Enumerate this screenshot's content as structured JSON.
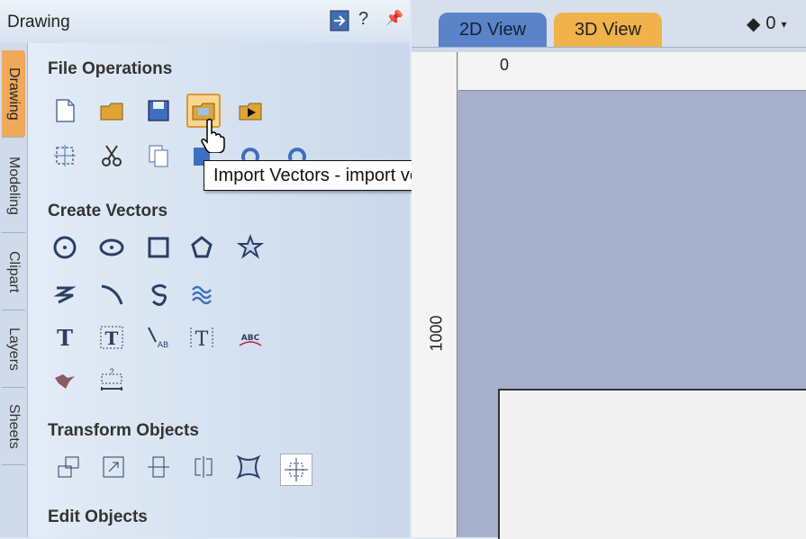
{
  "panel": {
    "title": "Drawing",
    "help": "?",
    "pin": "⊥"
  },
  "side_tabs": [
    "Drawing",
    "Modeling",
    "Clipart",
    "Layers",
    "Sheets"
  ],
  "sections": {
    "file_ops": "File Operations",
    "create_vectors": "Create Vectors",
    "transform": "Transform Objects",
    "edit": "Edit Objects"
  },
  "tooltip": "Import Vectors - import vectors from a file into current job",
  "view": {
    "tab_2d": "2D View",
    "tab_3d": "3D View",
    "zoom_value": "0"
  },
  "ruler": {
    "top_label": "0",
    "left_label": "1000"
  },
  "colors": {
    "active_tab": "#f0a859",
    "tab_2d": "#5a83c8",
    "tab_3d": "#f0b24b",
    "hover": "#f8d68f"
  }
}
